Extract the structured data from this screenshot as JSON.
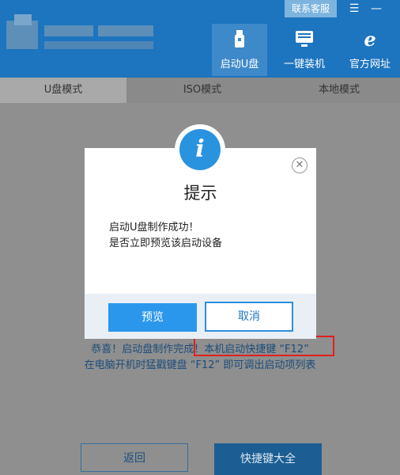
{
  "header": {
    "contact_label": "联系客服",
    "menu_symbol": "☰",
    "minimize_symbol": "—",
    "nav": [
      {
        "label": "启动U盘",
        "icon": "usb-drive-icon",
        "active": true
      },
      {
        "label": "一键装机",
        "icon": "monitor-icon",
        "active": false
      },
      {
        "label": "官方网址",
        "icon": "browser-e-icon",
        "active": false
      }
    ]
  },
  "tabs": [
    {
      "label": "U盘模式",
      "active": true
    },
    {
      "label": "ISO模式",
      "active": false
    },
    {
      "label": "本地模式",
      "active": false
    }
  ],
  "main": {
    "message_line1": "恭喜！启动盘制作完成！本机启动快捷键 “F12”",
    "message_line2": "在电脑开机时猛戳键盘 “F12” 即可调出启动项列表",
    "back_label": "返回",
    "hotkeys_label": "快捷键大全"
  },
  "dialog": {
    "icon": "info-icon",
    "icon_letter": "i",
    "close_symbol": "✕",
    "title": "提示",
    "line1": "启动U盘制作成功！",
    "line2": "是否立即预览该启动设备",
    "preview_label": "预览",
    "cancel_label": "取消"
  },
  "colors": {
    "header_bg": "#1d74bf",
    "accent": "#2b97ec",
    "highlight_box": "#e02020"
  }
}
